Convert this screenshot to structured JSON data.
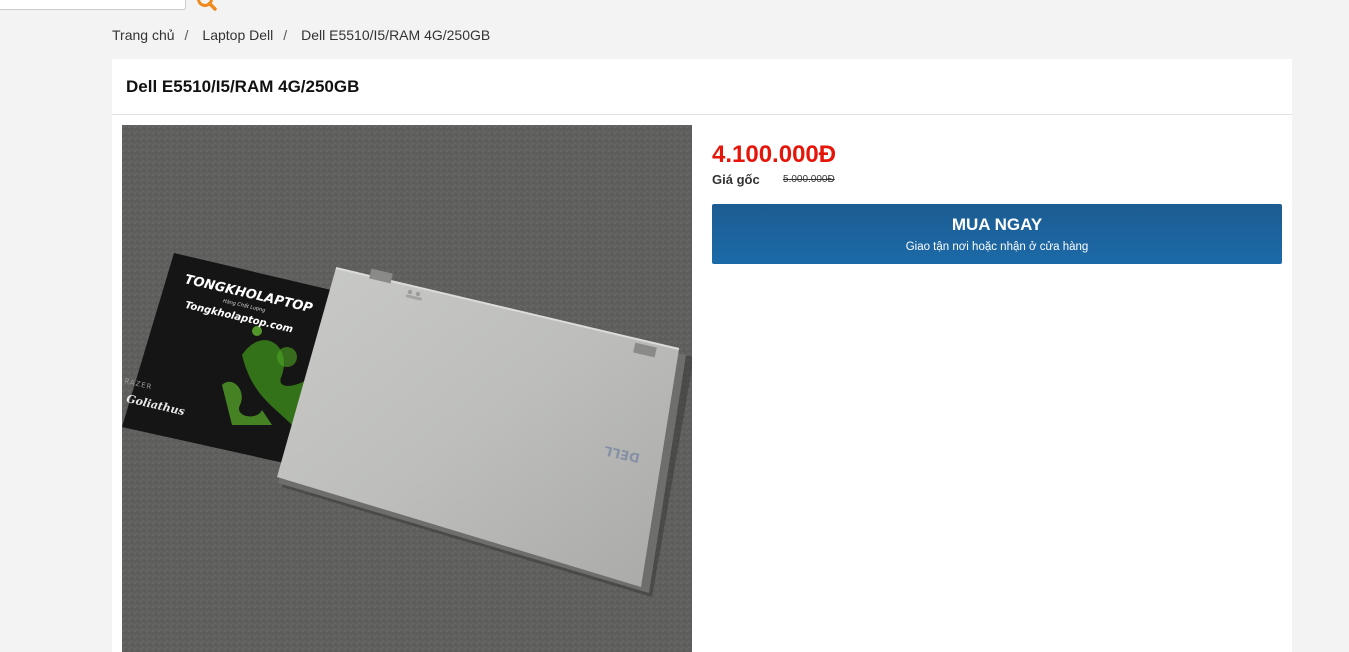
{
  "breadcrumb": {
    "home": "Trang chủ",
    "category": "Laptop Dell",
    "current": "Dell E5510/I5/RAM 4G/250GB",
    "separator": "/"
  },
  "product": {
    "title": "Dell E5510/I5/RAM 4G/250GB",
    "price": "4.100.000Đ",
    "original_label": "Giá gốc",
    "original_price": "5.000.000Đ",
    "image_alt": "Dell E5510 laptop on Tongkholaptop mouse pad",
    "mousepad_brand": "TONGKHOLAPTOP",
    "mousepad_tagline": "Hàng Chất Lượng",
    "mousepad_url": "Tongkholaptop.com",
    "mousepad_razer": "RAZER",
    "mousepad_series": "Goliathus",
    "laptop_logo": "DELL"
  },
  "buy": {
    "title": "MUA NGAY",
    "subtitle": "Giao tận nơi hoặc nhận ở cửa hàng"
  },
  "colors": {
    "price": "#e6150a",
    "buy_button": "#1b6aa8",
    "search_icon": "#f08a1c"
  },
  "icons": {
    "search": "search-icon"
  }
}
